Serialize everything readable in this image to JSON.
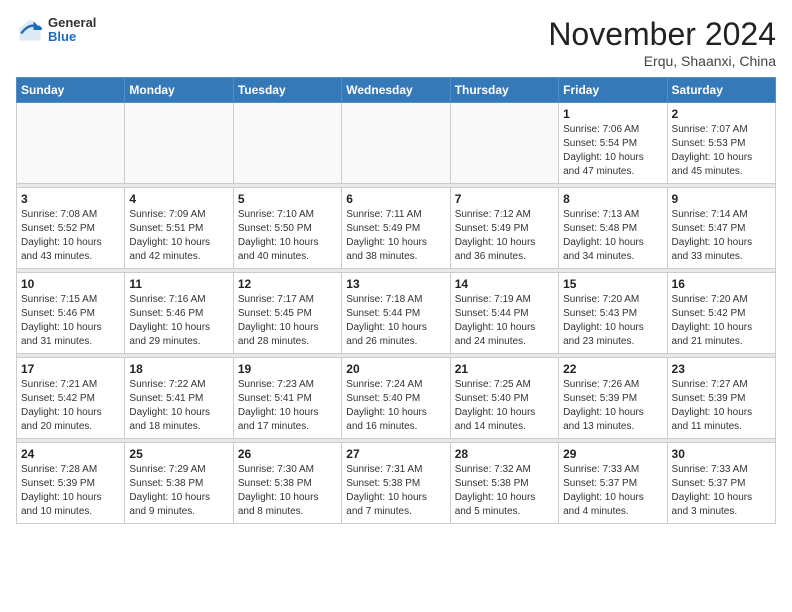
{
  "header": {
    "logo": {
      "line1": "General",
      "line2": "Blue"
    },
    "title": "November 2024",
    "location": "Erqu, Shaanxi, China"
  },
  "weekdays": [
    "Sunday",
    "Monday",
    "Tuesday",
    "Wednesday",
    "Thursday",
    "Friday",
    "Saturday"
  ],
  "weeks": [
    [
      {
        "day": "",
        "info": ""
      },
      {
        "day": "",
        "info": ""
      },
      {
        "day": "",
        "info": ""
      },
      {
        "day": "",
        "info": ""
      },
      {
        "day": "",
        "info": ""
      },
      {
        "day": "1",
        "info": "Sunrise: 7:06 AM\nSunset: 5:54 PM\nDaylight: 10 hours and 47 minutes."
      },
      {
        "day": "2",
        "info": "Sunrise: 7:07 AM\nSunset: 5:53 PM\nDaylight: 10 hours and 45 minutes."
      }
    ],
    [
      {
        "day": "3",
        "info": "Sunrise: 7:08 AM\nSunset: 5:52 PM\nDaylight: 10 hours and 43 minutes."
      },
      {
        "day": "4",
        "info": "Sunrise: 7:09 AM\nSunset: 5:51 PM\nDaylight: 10 hours and 42 minutes."
      },
      {
        "day": "5",
        "info": "Sunrise: 7:10 AM\nSunset: 5:50 PM\nDaylight: 10 hours and 40 minutes."
      },
      {
        "day": "6",
        "info": "Sunrise: 7:11 AM\nSunset: 5:49 PM\nDaylight: 10 hours and 38 minutes."
      },
      {
        "day": "7",
        "info": "Sunrise: 7:12 AM\nSunset: 5:49 PM\nDaylight: 10 hours and 36 minutes."
      },
      {
        "day": "8",
        "info": "Sunrise: 7:13 AM\nSunset: 5:48 PM\nDaylight: 10 hours and 34 minutes."
      },
      {
        "day": "9",
        "info": "Sunrise: 7:14 AM\nSunset: 5:47 PM\nDaylight: 10 hours and 33 minutes."
      }
    ],
    [
      {
        "day": "10",
        "info": "Sunrise: 7:15 AM\nSunset: 5:46 PM\nDaylight: 10 hours and 31 minutes."
      },
      {
        "day": "11",
        "info": "Sunrise: 7:16 AM\nSunset: 5:46 PM\nDaylight: 10 hours and 29 minutes."
      },
      {
        "day": "12",
        "info": "Sunrise: 7:17 AM\nSunset: 5:45 PM\nDaylight: 10 hours and 28 minutes."
      },
      {
        "day": "13",
        "info": "Sunrise: 7:18 AM\nSunset: 5:44 PM\nDaylight: 10 hours and 26 minutes."
      },
      {
        "day": "14",
        "info": "Sunrise: 7:19 AM\nSunset: 5:44 PM\nDaylight: 10 hours and 24 minutes."
      },
      {
        "day": "15",
        "info": "Sunrise: 7:20 AM\nSunset: 5:43 PM\nDaylight: 10 hours and 23 minutes."
      },
      {
        "day": "16",
        "info": "Sunrise: 7:20 AM\nSunset: 5:42 PM\nDaylight: 10 hours and 21 minutes."
      }
    ],
    [
      {
        "day": "17",
        "info": "Sunrise: 7:21 AM\nSunset: 5:42 PM\nDaylight: 10 hours and 20 minutes."
      },
      {
        "day": "18",
        "info": "Sunrise: 7:22 AM\nSunset: 5:41 PM\nDaylight: 10 hours and 18 minutes."
      },
      {
        "day": "19",
        "info": "Sunrise: 7:23 AM\nSunset: 5:41 PM\nDaylight: 10 hours and 17 minutes."
      },
      {
        "day": "20",
        "info": "Sunrise: 7:24 AM\nSunset: 5:40 PM\nDaylight: 10 hours and 16 minutes."
      },
      {
        "day": "21",
        "info": "Sunrise: 7:25 AM\nSunset: 5:40 PM\nDaylight: 10 hours and 14 minutes."
      },
      {
        "day": "22",
        "info": "Sunrise: 7:26 AM\nSunset: 5:39 PM\nDaylight: 10 hours and 13 minutes."
      },
      {
        "day": "23",
        "info": "Sunrise: 7:27 AM\nSunset: 5:39 PM\nDaylight: 10 hours and 11 minutes."
      }
    ],
    [
      {
        "day": "24",
        "info": "Sunrise: 7:28 AM\nSunset: 5:39 PM\nDaylight: 10 hours and 10 minutes."
      },
      {
        "day": "25",
        "info": "Sunrise: 7:29 AM\nSunset: 5:38 PM\nDaylight: 10 hours and 9 minutes."
      },
      {
        "day": "26",
        "info": "Sunrise: 7:30 AM\nSunset: 5:38 PM\nDaylight: 10 hours and 8 minutes."
      },
      {
        "day": "27",
        "info": "Sunrise: 7:31 AM\nSunset: 5:38 PM\nDaylight: 10 hours and 7 minutes."
      },
      {
        "day": "28",
        "info": "Sunrise: 7:32 AM\nSunset: 5:38 PM\nDaylight: 10 hours and 5 minutes."
      },
      {
        "day": "29",
        "info": "Sunrise: 7:33 AM\nSunset: 5:37 PM\nDaylight: 10 hours and 4 minutes."
      },
      {
        "day": "30",
        "info": "Sunrise: 7:33 AM\nSunset: 5:37 PM\nDaylight: 10 hours and 3 minutes."
      }
    ]
  ]
}
